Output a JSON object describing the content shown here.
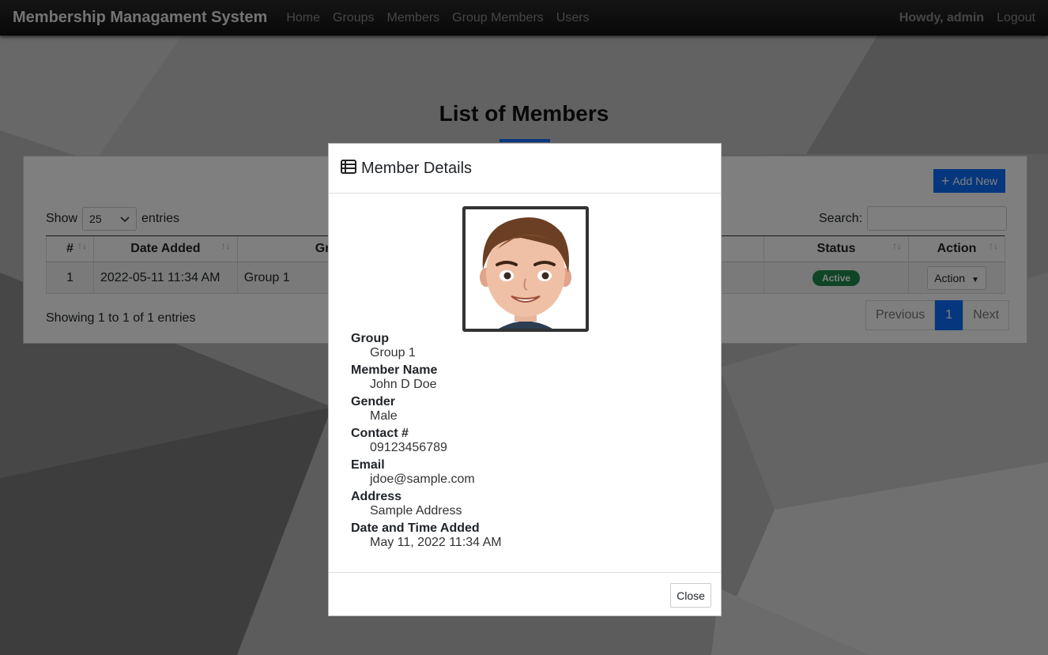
{
  "navbar": {
    "brand": "Membership Managament System",
    "links": [
      "Home",
      "Groups",
      "Members",
      "Group Members",
      "Users"
    ],
    "howdy": "Howdy, admin",
    "logout": "Logout"
  },
  "page": {
    "title": "List of Members",
    "add_new_label": "Add New",
    "show_label": "Show",
    "entries_label": "entries",
    "page_length": "25",
    "search_label": "Search:",
    "columns": [
      "#",
      "Date Added",
      "Gr",
      "Status",
      "Action"
    ],
    "rows": [
      {
        "num": "1",
        "date": "2022-05-11 11:34 AM",
        "group": "Group 1",
        "status": "Active",
        "action": "Action"
      }
    ],
    "showing": "Showing 1 to 1 of 1 entries",
    "pagination": {
      "previous": "Previous",
      "current": "1",
      "next": "Next"
    }
  },
  "modal": {
    "title": "Member Details",
    "fields": [
      {
        "label": "Group",
        "value": "Group 1"
      },
      {
        "label": "Member Name",
        "value": "John D Doe"
      },
      {
        "label": "Gender",
        "value": "Male"
      },
      {
        "label": "Contact #",
        "value": "09123456789"
      },
      {
        "label": "Email",
        "value": "jdoe@sample.com"
      },
      {
        "label": "Address",
        "value": "Sample Address"
      },
      {
        "label": "Date and Time Added",
        "value": "May 11, 2022 11:34 AM"
      }
    ],
    "close_label": "Close"
  },
  "colors": {
    "primary": "#0d6efd",
    "success": "#1f8a4c",
    "navbar": "#1a1a1a"
  }
}
